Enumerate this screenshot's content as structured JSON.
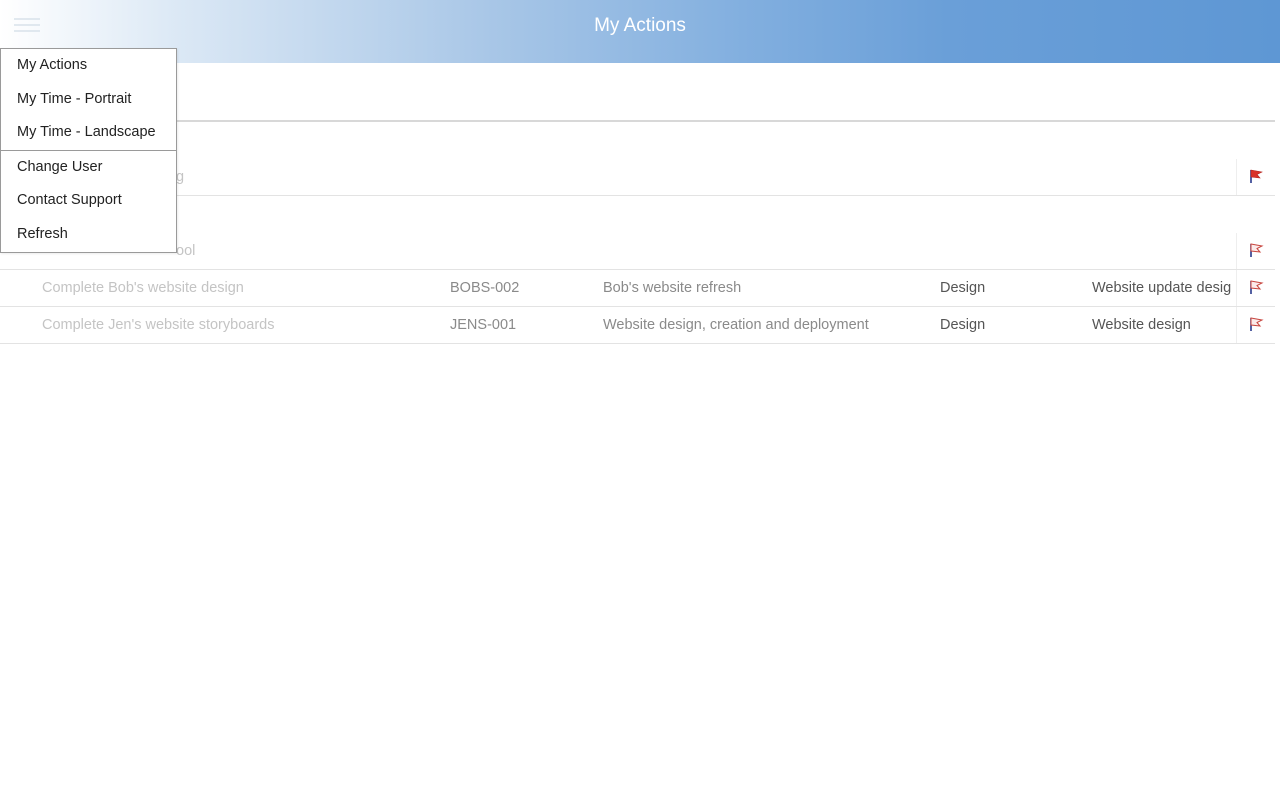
{
  "header": {
    "title": "My Actions"
  },
  "menu": {
    "items_primary": [
      "My Actions",
      "My Time - Portrait",
      "My Time - Landscape"
    ],
    "items_secondary": [
      "Change User",
      "Contact Support",
      "Refresh"
    ]
  },
  "rows": [
    {
      "description": "g",
      "code": "",
      "project": "",
      "type": "",
      "category": "",
      "flag": "red-flag-icon"
    },
    {
      "description": "ool",
      "code": "",
      "project": "",
      "type": "",
      "category": "",
      "flag": "outline-flag-icon"
    },
    {
      "description": "Complete Bob's website design",
      "code": "BOBS-002",
      "project": "Bob's website refresh",
      "type": "Design",
      "category": "Website update desig",
      "flag": "outline-flag-icon"
    },
    {
      "description": "Complete Jen's website storyboards",
      "code": "JENS-001",
      "project": "Website design, creation and deployment",
      "type": "Design",
      "category": "Website design",
      "flag": "outline-flag-icon"
    }
  ],
  "colors": {
    "header_gradient_end": "#5e97d4",
    "flag_red": "#d9322a",
    "flag_outline": "#c8463f",
    "flag_pole": "#2a3a8c"
  }
}
